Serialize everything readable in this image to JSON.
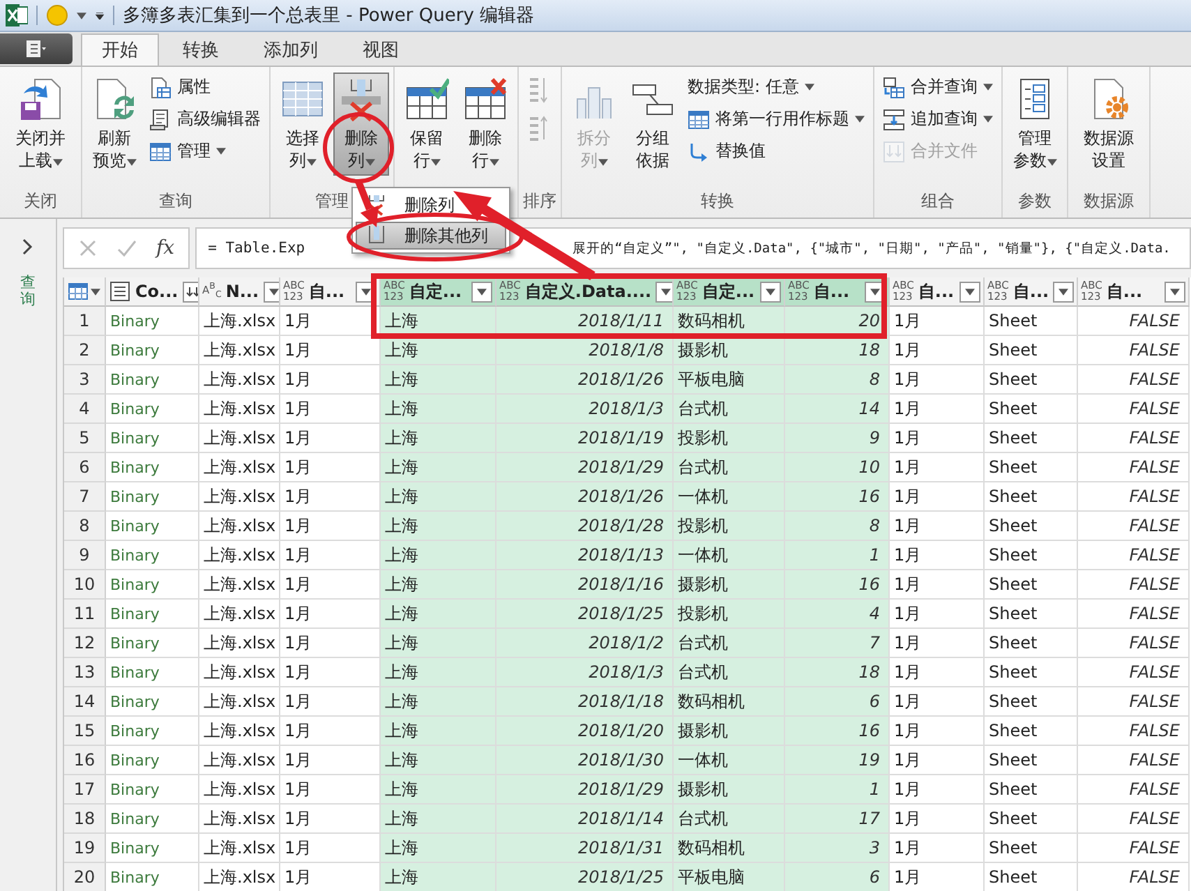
{
  "window": {
    "title": "多簿多表汇集到一个总表里 - Power Query 编辑器"
  },
  "tabs": [
    {
      "label": "开始",
      "selected": true
    },
    {
      "label": "转换",
      "selected": false
    },
    {
      "label": "添加列",
      "selected": false
    },
    {
      "label": "视图",
      "selected": false
    }
  ],
  "ribbon": {
    "groups": [
      {
        "label": "关闭",
        "large": [
          {
            "label": "关闭并上载",
            "dropdown": true,
            "disabled": false,
            "pressed": false
          }
        ]
      },
      {
        "label": "查询",
        "large": [
          {
            "label": "刷新预览",
            "dropdown": true,
            "disabled": false,
            "pressed": false
          }
        ],
        "small": [
          {
            "label": "属性",
            "dropdown": false,
            "disabled": false
          },
          {
            "label": "高级编辑器",
            "dropdown": false,
            "disabled": false
          },
          {
            "label": "管理",
            "dropdown": true,
            "disabled": false
          }
        ]
      },
      {
        "label": "管理",
        "large": [
          {
            "label": "选择列",
            "dropdown": true,
            "disabled": false,
            "pressed": false
          },
          {
            "label": "删除列",
            "dropdown": true,
            "disabled": false,
            "pressed": true
          }
        ]
      },
      {
        "large": [
          {
            "label": "保留行",
            "dropdown": true,
            "disabled": false,
            "pressed": false
          },
          {
            "label": "删除行",
            "dropdown": true,
            "disabled": false,
            "pressed": false
          }
        ]
      },
      {
        "label": "排序",
        "small": [
          {
            "dropdown": false,
            "disabled": true
          },
          {
            "dropdown": false,
            "disabled": true
          }
        ]
      },
      {
        "label": "转换",
        "large": [
          {
            "label": "拆分列",
            "dropdown": true,
            "disabled": true,
            "pressed": false
          },
          {
            "label": "分组依据",
            "dropdown": false,
            "disabled": false,
            "pressed": false
          }
        ],
        "small": [
          {
            "label": "数据类型: 任意",
            "dropdown": true,
            "disabled": false
          },
          {
            "label": "将第一行用作标题",
            "dropdown": true,
            "disabled": false
          },
          {
            "label": "替换值",
            "dropdown": false,
            "disabled": false
          }
        ]
      },
      {
        "label": "组合",
        "small": [
          {
            "label": "合并查询",
            "dropdown": true,
            "disabled": false
          },
          {
            "label": "追加查询",
            "dropdown": true,
            "disabled": false
          },
          {
            "label": "合并文件",
            "dropdown": false,
            "disabled": true
          }
        ]
      },
      {
        "label": "参数",
        "large": [
          {
            "label": "管理参数",
            "dropdown": true,
            "disabled": false,
            "pressed": false
          }
        ]
      },
      {
        "label": "数据源",
        "large": [
          {
            "label": "数据源设置",
            "dropdown": false,
            "disabled": false,
            "pressed": false
          }
        ]
      }
    ]
  },
  "queries_pane": {
    "label": "查询"
  },
  "formula_bar": {
    "fx": "fx",
    "text_start": "= Table.Exp",
    "text_end": "展开的“自定义”\", \"自定义.Data\", {\"城市\", \"日期\", \"产品\", \"销量\"}, {\"自定义.Data."
  },
  "dropdown_menu": {
    "items": [
      {
        "label": "删除列",
        "selected": false
      },
      {
        "label": "删除其他列",
        "selected": true
      }
    ]
  },
  "columns": [
    {
      "name": "Co...",
      "kind": "binary",
      "selected": false
    },
    {
      "name": "N...",
      "kind": "text",
      "type_label": "A$^{B}$$_{C}$",
      "selected": false
    },
    {
      "name": "自...",
      "kind": "text",
      "type_label": "ABC\n123",
      "selected": false
    },
    {
      "name": "自定...",
      "kind": "text",
      "type_label": "ABC\n123",
      "selected": true
    },
    {
      "name": "自定义.Data....",
      "kind": "date",
      "type_label": "ABC\n123",
      "selected": true
    },
    {
      "name": "自定...",
      "kind": "text",
      "type_label": "ABC\n123",
      "selected": true
    },
    {
      "name": "自...",
      "kind": "number",
      "type_label": "ABC\n123",
      "selected": true
    },
    {
      "name": "自...",
      "kind": "text",
      "type_label": "ABC\n123",
      "selected": false
    },
    {
      "name": "自...",
      "kind": "text",
      "type_label": "ABC\n123",
      "selected": false
    },
    {
      "name": "自...",
      "kind": "logical",
      "type_label": "ABC\n123",
      "selected": false
    }
  ],
  "rows": [
    {
      "number": "1",
      "cells": [
        "Binary",
        "上海.xlsx",
        "1月",
        "上海",
        "2018/1/11",
        "数码相机",
        "20",
        "1月",
        "Sheet",
        "FALSE"
      ]
    },
    {
      "number": "2",
      "cells": [
        "Binary",
        "上海.xlsx",
        "1月",
        "上海",
        "2018/1/8",
        "摄影机",
        "18",
        "1月",
        "Sheet",
        "FALSE"
      ]
    },
    {
      "number": "3",
      "cells": [
        "Binary",
        "上海.xlsx",
        "1月",
        "上海",
        "2018/1/26",
        "平板电脑",
        "8",
        "1月",
        "Sheet",
        "FALSE"
      ]
    },
    {
      "number": "4",
      "cells": [
        "Binary",
        "上海.xlsx",
        "1月",
        "上海",
        "2018/1/3",
        "台式机",
        "14",
        "1月",
        "Sheet",
        "FALSE"
      ]
    },
    {
      "number": "5",
      "cells": [
        "Binary",
        "上海.xlsx",
        "1月",
        "上海",
        "2018/1/19",
        "投影机",
        "9",
        "1月",
        "Sheet",
        "FALSE"
      ]
    },
    {
      "number": "6",
      "cells": [
        "Binary",
        "上海.xlsx",
        "1月",
        "上海",
        "2018/1/29",
        "台式机",
        "10",
        "1月",
        "Sheet",
        "FALSE"
      ]
    },
    {
      "number": "7",
      "cells": [
        "Binary",
        "上海.xlsx",
        "1月",
        "上海",
        "2018/1/26",
        "一体机",
        "16",
        "1月",
        "Sheet",
        "FALSE"
      ]
    },
    {
      "number": "8",
      "cells": [
        "Binary",
        "上海.xlsx",
        "1月",
        "上海",
        "2018/1/28",
        "投影机",
        "8",
        "1月",
        "Sheet",
        "FALSE"
      ]
    },
    {
      "number": "9",
      "cells": [
        "Binary",
        "上海.xlsx",
        "1月",
        "上海",
        "2018/1/13",
        "一体机",
        "1",
        "1月",
        "Sheet",
        "FALSE"
      ]
    },
    {
      "number": "10",
      "cells": [
        "Binary",
        "上海.xlsx",
        "1月",
        "上海",
        "2018/1/16",
        "摄影机",
        "16",
        "1月",
        "Sheet",
        "FALSE"
      ]
    },
    {
      "number": "11",
      "cells": [
        "Binary",
        "上海.xlsx",
        "1月",
        "上海",
        "2018/1/25",
        "投影机",
        "4",
        "1月",
        "Sheet",
        "FALSE"
      ]
    },
    {
      "number": "12",
      "cells": [
        "Binary",
        "上海.xlsx",
        "1月",
        "上海",
        "2018/1/2",
        "台式机",
        "7",
        "1月",
        "Sheet",
        "FALSE"
      ]
    },
    {
      "number": "13",
      "cells": [
        "Binary",
        "上海.xlsx",
        "1月",
        "上海",
        "2018/1/3",
        "台式机",
        "18",
        "1月",
        "Sheet",
        "FALSE"
      ]
    },
    {
      "number": "14",
      "cells": [
        "Binary",
        "上海.xlsx",
        "1月",
        "上海",
        "2018/1/18",
        "数码相机",
        "6",
        "1月",
        "Sheet",
        "FALSE"
      ]
    },
    {
      "number": "15",
      "cells": [
        "Binary",
        "上海.xlsx",
        "1月",
        "上海",
        "2018/1/20",
        "摄影机",
        "16",
        "1月",
        "Sheet",
        "FALSE"
      ]
    },
    {
      "number": "16",
      "cells": [
        "Binary",
        "上海.xlsx",
        "1月",
        "上海",
        "2018/1/30",
        "一体机",
        "19",
        "1月",
        "Sheet",
        "FALSE"
      ]
    },
    {
      "number": "17",
      "cells": [
        "Binary",
        "上海.xlsx",
        "1月",
        "上海",
        "2018/1/29",
        "摄影机",
        "1",
        "1月",
        "Sheet",
        "FALSE"
      ]
    },
    {
      "number": "18",
      "cells": [
        "Binary",
        "上海.xlsx",
        "1月",
        "上海",
        "2018/1/14",
        "台式机",
        "17",
        "1月",
        "Sheet",
        "FALSE"
      ]
    },
    {
      "number": "19",
      "cells": [
        "Binary",
        "上海.xlsx",
        "1月",
        "上海",
        "2018/1/31",
        "数码相机",
        "3",
        "1月",
        "Sheet",
        "FALSE"
      ]
    },
    {
      "number": "20",
      "cells": [
        "Binary",
        "上海.xlsx",
        "1月",
        "上海",
        "2018/1/25",
        "平板电脑",
        "6",
        "1月",
        "Sheet",
        "FALSE"
      ]
    }
  ]
}
